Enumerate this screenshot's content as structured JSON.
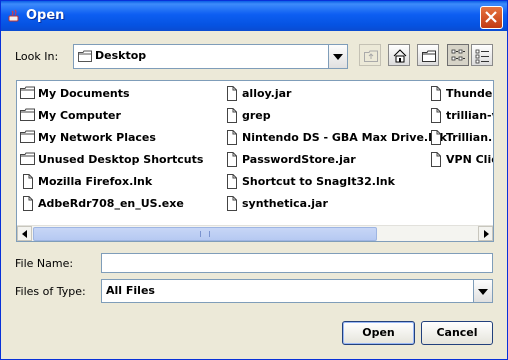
{
  "window": {
    "title": "Open"
  },
  "look_in": {
    "label": "Look In:",
    "value": "Desktop"
  },
  "toolbar": {
    "icons": [
      "up-one-level-icon",
      "home-icon",
      "new-folder-icon",
      "list-view-icon",
      "details-view-icon"
    ]
  },
  "files": [
    {
      "name": "My Documents",
      "type": "folder"
    },
    {
      "name": "My Computer",
      "type": "folder"
    },
    {
      "name": "My Network Places",
      "type": "folder"
    },
    {
      "name": "Unused Desktop Shortcuts",
      "type": "folder"
    },
    {
      "name": "Mozilla Firefox.lnk",
      "type": "file"
    },
    {
      "name": "AdbeRdr708_en_US.exe",
      "type": "file"
    },
    {
      "name": "alloy.jar",
      "type": "file"
    },
    {
      "name": "grep",
      "type": "file"
    },
    {
      "name": "Nintendo DS - GBA Max Drive.lnk",
      "type": "file"
    },
    {
      "name": "PasswordStore.jar",
      "type": "file"
    },
    {
      "name": "Shortcut to SnagIt32.lnk",
      "type": "file"
    },
    {
      "name": "synthetica.jar",
      "type": "file"
    },
    {
      "name": "Thunder",
      "type": "file"
    },
    {
      "name": "trillian-v",
      "type": "file"
    },
    {
      "name": "Trillian.l",
      "type": "file"
    },
    {
      "name": "VPN Clie",
      "type": "file"
    }
  ],
  "file_name": {
    "label": "File Name:",
    "value": ""
  },
  "file_type": {
    "label": "Files of Type:",
    "value": "All Files"
  },
  "buttons": {
    "open": "Open",
    "cancel": "Cancel"
  },
  "colors": {
    "title_bar": "#0a5fe6",
    "dialog_bg": "#ece9d8",
    "border": "#7f9db9"
  }
}
